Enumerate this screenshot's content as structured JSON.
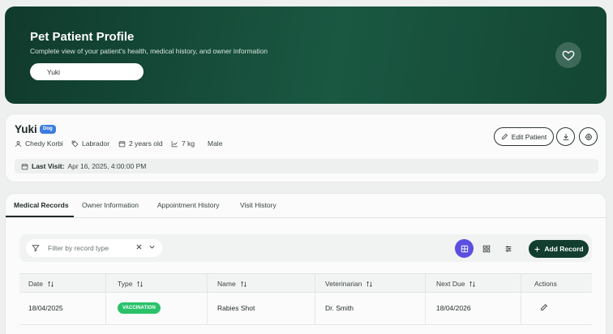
{
  "hero": {
    "title": "Pet Patient Profile",
    "subtitle": "Complete view of your patient's health, medical history, and owner information",
    "search_value": "Yuki"
  },
  "profile": {
    "name": "Yuki",
    "species": "Dog",
    "owner": "Chedy Korbi",
    "breed": "Labrador",
    "age": "2 years old",
    "weight": "7 kg",
    "sex": "Male",
    "last_visit_label": "Last Visit:",
    "last_visit_value": "Apr 16, 2025, 4:00:00 PM",
    "edit_label": "Edit Patient"
  },
  "tabs": [
    {
      "label": "Medical Records",
      "active": true
    },
    {
      "label": "Owner Information",
      "active": false
    },
    {
      "label": "Appointment History",
      "active": false
    },
    {
      "label": "Visit History",
      "active": false
    }
  ],
  "toolbar": {
    "filter_placeholder": "Filter by record type",
    "add_label": "Add Record"
  },
  "table": {
    "columns": [
      "Date",
      "Type",
      "Name",
      "Veterinarian",
      "Next Due",
      "Actions"
    ],
    "rows": [
      {
        "date": "18/04/2025",
        "type": "VACCINATION",
        "name": "Rabies Shot",
        "vet": "Dr. Smith",
        "next_due": "18/04/2026"
      }
    ]
  },
  "colors": {
    "hero_dark": "#103a2c",
    "accent_green": "#29c26a",
    "accent_purple": "#5b4fe0",
    "badge_blue": "#3c7be0",
    "button_dark": "#123d2f"
  }
}
